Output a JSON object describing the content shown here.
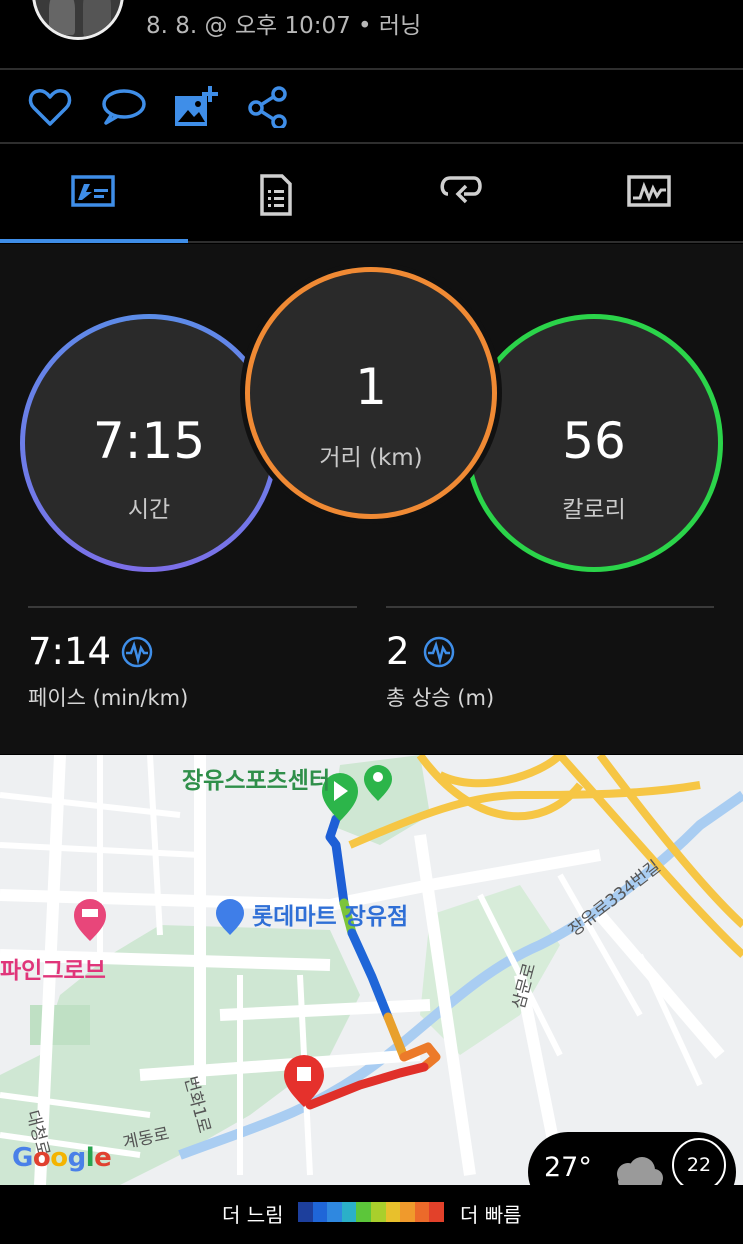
{
  "header": {
    "activity_meta": "8. 8. @ 오후 10:07 • 러닝"
  },
  "actions": {
    "like_icon": "heart-icon",
    "comment_icon": "comment-icon",
    "add_photo_icon": "add-photo-icon",
    "share_icon": "share-icon"
  },
  "tabs": [
    {
      "icon": "overview-icon",
      "active": true
    },
    {
      "icon": "details-icon",
      "active": false
    },
    {
      "icon": "laps-icon",
      "active": false
    },
    {
      "icon": "charts-icon",
      "active": false
    }
  ],
  "stats": {
    "time": {
      "value": "7:15",
      "label": "시간"
    },
    "distance": {
      "value": "1",
      "label": "거리 (km)"
    },
    "calories": {
      "value": "56",
      "label": "칼로리"
    },
    "pace": {
      "value": "7:14",
      "label": "페이스 (min/km)"
    },
    "elevation": {
      "value": "2",
      "label": "총 상승 (m)"
    }
  },
  "colors": {
    "accent": "#3f8ee8",
    "time_ring": "#6b7ee8",
    "distance_ring": "#f08a34",
    "calories_ring": "#2bd44a",
    "route_slow": "#1e5fd6",
    "route_fast": "#e0302a"
  },
  "map": {
    "poi_sports_center": "장유스포츠센터",
    "poi_lotte_mart": "롯데마트 장유점",
    "poi_hotel": "파인그로브",
    "road_jangyuro": "장유로334번길",
    "road_sammunro": "삼문로",
    "road_beonhwa": "번화1로",
    "road_gyedong": "계동로",
    "road_daecheong": "대청로",
    "google_logo": "Google",
    "weather": {
      "temperature": "27°",
      "icon": "cloud-icon",
      "aqi": "22"
    }
  },
  "legend": {
    "slow_label": "더 느림",
    "fast_label": "더 빠름",
    "colors": [
      "#1d3f9c",
      "#1f66d8",
      "#2f88e0",
      "#2bb0c8",
      "#5cc63a",
      "#a9cf2c",
      "#e8c02c",
      "#f09a2c",
      "#ec6a2a",
      "#e2412a"
    ]
  }
}
